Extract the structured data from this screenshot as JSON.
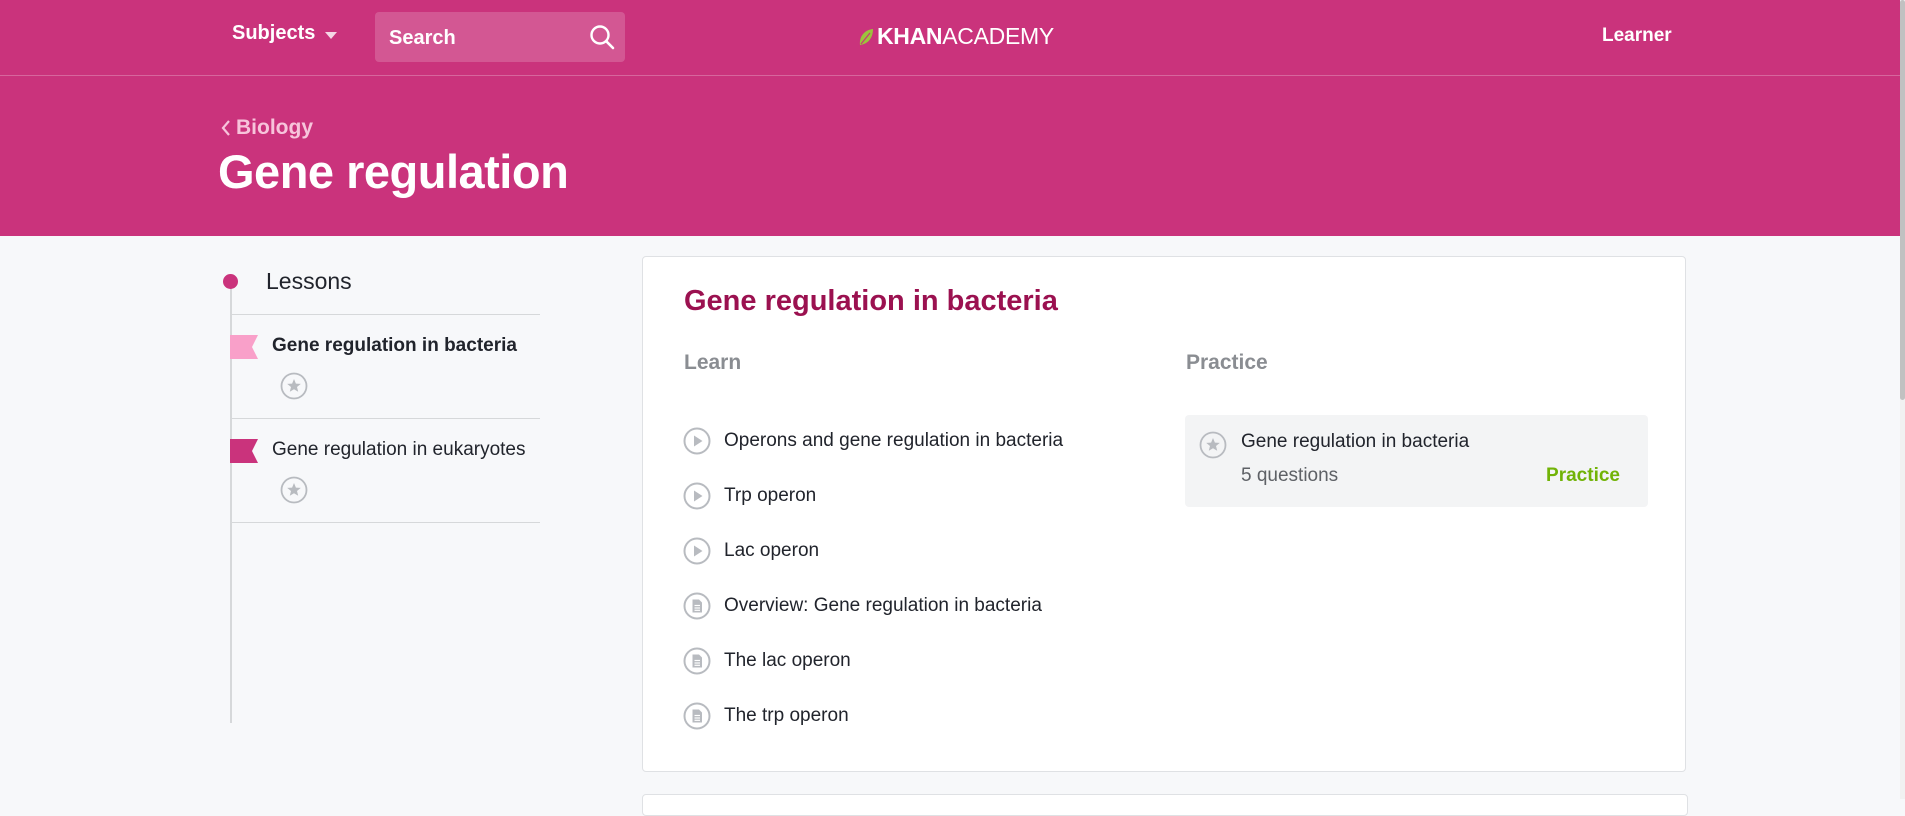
{
  "nav": {
    "subjects_label": "Subjects",
    "search_placeholder": "Search",
    "logo_bold": "KHAN",
    "logo_light": "ACADEMY",
    "learner_label": "Learner"
  },
  "hero": {
    "breadcrumb": "Biology",
    "title": "Gene regulation"
  },
  "sidebar": {
    "heading": "Lessons",
    "items": [
      {
        "label": "Gene regulation in bacteria"
      },
      {
        "label": "Gene regulation in eukaryotes"
      }
    ]
  },
  "lesson": {
    "title": "Gene regulation in bacteria",
    "learn_heading": "Learn",
    "practice_heading": "Practice",
    "learn_items": [
      {
        "label": "Operons and gene regulation in bacteria",
        "icon": "video-icon"
      },
      {
        "label": "Trp operon",
        "icon": "video-icon"
      },
      {
        "label": "Lac operon",
        "icon": "video-icon"
      },
      {
        "label": "Overview: Gene regulation in bacteria",
        "icon": "article-icon"
      },
      {
        "label": "The lac operon",
        "icon": "article-icon"
      },
      {
        "label": "The trp operon",
        "icon": "article-icon"
      }
    ],
    "practice": {
      "title": "Gene regulation in bacteria",
      "count": "5 questions",
      "button": "Practice"
    }
  },
  "colors": {
    "brand": "#ca337c",
    "title": "#9b1150",
    "practice_green": "#71b307"
  }
}
